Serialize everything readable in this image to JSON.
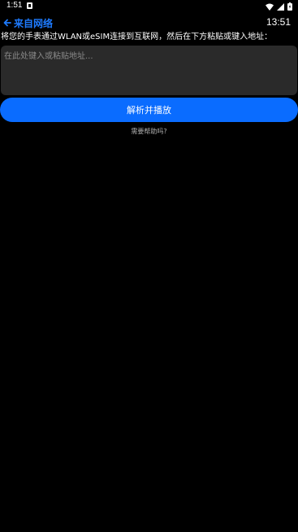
{
  "status_bar": {
    "time": "1:51",
    "notification_icon": "notification-icon",
    "icons": [
      "wifi-icon",
      "signal-icon",
      "battery-icon"
    ]
  },
  "header": {
    "back_icon": "back-arrow-icon",
    "title": "来自网络",
    "clock": "13:51",
    "accent_color": "#1e7bff"
  },
  "main": {
    "instruction": "将您的手表通过WLAN或eSIM连接到互联网，然后在下方粘贴或键入地址：",
    "url_input": {
      "value": "",
      "placeholder": "在此处键入或粘贴地址..."
    },
    "parse_button_label": "解析并播放",
    "parse_button_color": "#0a6cff",
    "help_link": "需要帮助吗?"
  }
}
